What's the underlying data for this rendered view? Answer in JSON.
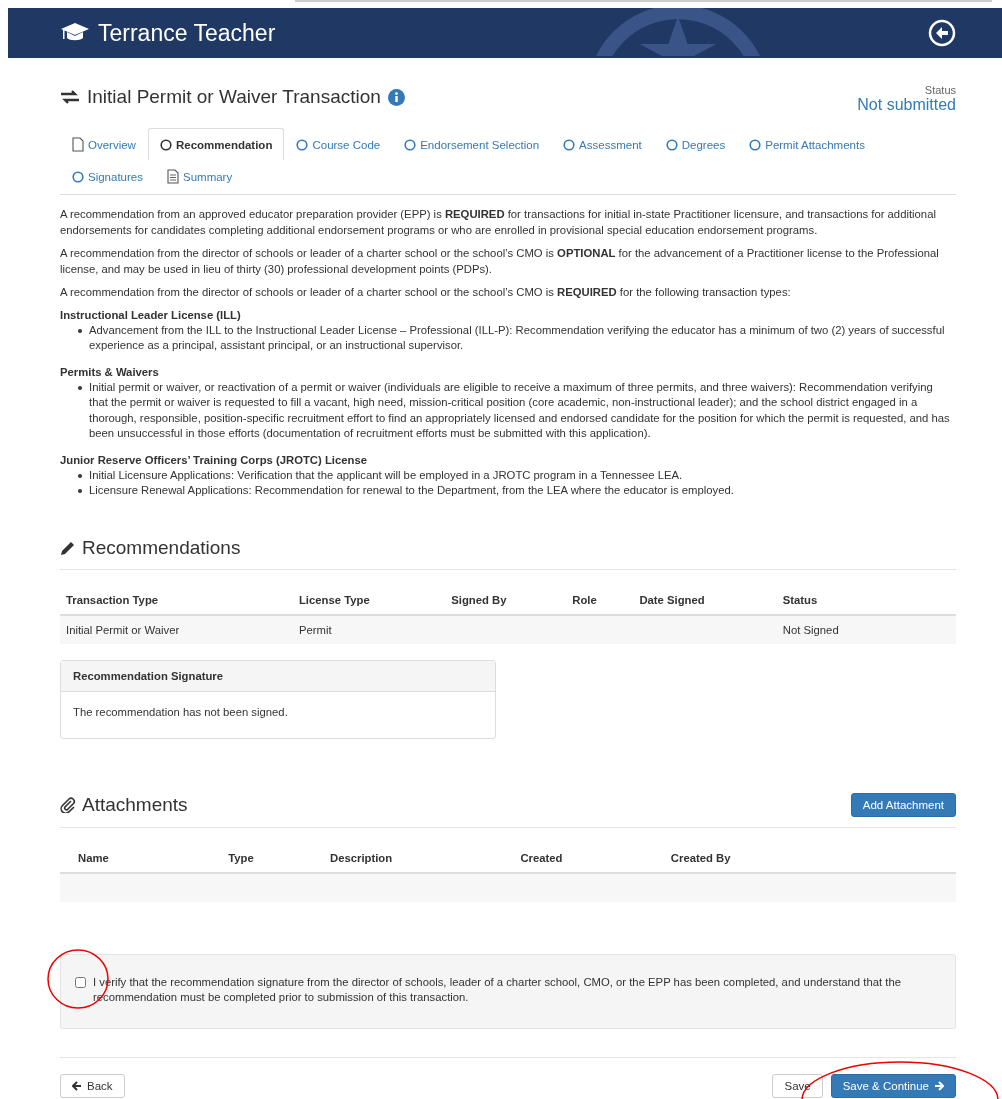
{
  "header": {
    "title": "Terrance Teacher"
  },
  "status": {
    "label": "Status",
    "value": "Not submitted"
  },
  "page_title": "Initial Permit or Waiver Transaction",
  "tabs": [
    {
      "label": "Overview",
      "kind": "page",
      "selected": false
    },
    {
      "label": "Recommendation",
      "kind": "step",
      "selected": true
    },
    {
      "label": "Course Code",
      "kind": "step",
      "selected": false
    },
    {
      "label": "Endorsement Selection",
      "kind": "step",
      "selected": false
    },
    {
      "label": "Assessment",
      "kind": "step",
      "selected": false
    },
    {
      "label": "Degrees",
      "kind": "step",
      "selected": false
    },
    {
      "label": "Permit Attachments",
      "kind": "step",
      "selected": false
    },
    {
      "label": "Signatures",
      "kind": "step",
      "selected": false
    },
    {
      "label": "Summary",
      "kind": "report",
      "selected": false
    }
  ],
  "intro": [
    "A recommendation from an approved educator preparation provider (EPP) is **REQUIRED** for transactions for initial in-state Practitioner licensure, and transactions for additional endorsements for candidates completing additional endorsement programs or who are enrolled in provisional special education endorsement programs.",
    "A recommendation from the director of schools or leader of a charter school or the school’s CMO is **OPTIONAL** for the advancement of a Practitioner license to the Professional license, and may be used in lieu of thirty (30) professional development points (PDPs).",
    "A recommendation from the director of schools or leader of a charter school or the school’s CMO is **REQUIRED** for the following transaction types:"
  ],
  "sections": [
    {
      "heading": "Instructional Leader License (ILL)",
      "items": [
        "Advancement from the ILL to the Instructional Leader License – Professional (ILL-P): Recommendation verifying the educator has a minimum of two (2) years of successful experience as a principal, assistant principal, or an instructional supervisor."
      ]
    },
    {
      "heading": "Permits & Waivers",
      "items": [
        "Initial permit or waiver, or reactivation of a permit or waiver (individuals are eligible to receive a maximum of three permits, and three waivers): Recommendation verifying that the permit or waiver is requested to fill a vacant, high need, mission-critical position (core academic, non-instructional leader); and the school district engaged in a thorough, responsible, position-specific recruitment effort to find an appropriately licensed and endorsed candidate for the position for which the permit is requested, and has been unsuccessful in those efforts (documentation of recruitment efforts must be submitted with this application)."
      ]
    },
    {
      "heading": "Junior Reserve Officers’ Training Corps (JROTC) License",
      "items": [
        "Initial Licensure Applications: Verification that the applicant will be employed in a JROTC program in a Tennessee LEA.",
        "Licensure Renewal Applications: Recommendation for renewal to the Department, from the LEA where the educator is employed."
      ]
    }
  ],
  "recommendations": {
    "heading": "Recommendations",
    "columns": [
      "Transaction Type",
      "License Type",
      "Signed By",
      "Role",
      "Date Signed",
      "Status"
    ],
    "rows": [
      [
        "Initial Permit or Waiver",
        "Permit",
        "",
        "",
        "",
        "Not Signed"
      ]
    ],
    "signature_panel": {
      "title": "Recommendation Signature",
      "message": "The recommendation has not been signed."
    }
  },
  "attachments": {
    "heading": "Attachments",
    "add_button": "Add Attachment",
    "columns": [
      "Name",
      "Type",
      "Description",
      "Created",
      "Created By"
    ]
  },
  "verification": {
    "text": "I verify that the recommendation signature from the director of schools, leader of a charter school, CMO, or the EPP has been completed, and understand that the recommendation must be completed prior to submission of this transaction.",
    "checked": false
  },
  "footer": {
    "back": "Back",
    "save": "Save",
    "save_continue": "Save & Continue"
  }
}
